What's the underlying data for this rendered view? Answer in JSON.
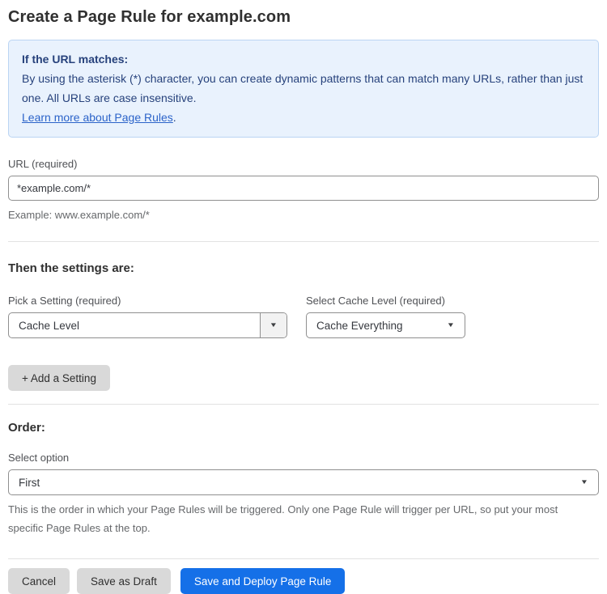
{
  "page": {
    "title": "Create a Page Rule for example.com"
  },
  "info_box": {
    "heading": "If the URL matches:",
    "body": "By using the asterisk (*) character, you can create dynamic patterns that can match many URLs, rather than just one. All URLs are case insensitive.",
    "link_label": "Learn more about Page Rules",
    "link_suffix": "."
  },
  "url_field": {
    "label": "URL (required)",
    "value": "*example.com/*",
    "helper": "Example: www.example.com/*"
  },
  "settings_section": {
    "heading": "Then the settings are:",
    "pick_setting": {
      "label": "Pick a Setting (required)",
      "value": "Cache Level"
    },
    "cache_level": {
      "label": "Select Cache Level (required)",
      "value": "Cache Everything"
    },
    "add_setting_label": "+ Add a Setting"
  },
  "order_section": {
    "heading": "Order:",
    "select_label": "Select option",
    "value": "First",
    "helper": "This is the order in which your Page Rules will be triggered. Only one Page Rule will trigger per URL, so put your most specific Page Rules at the top."
  },
  "actions": {
    "cancel": "Cancel",
    "save_draft": "Save as Draft",
    "save_deploy": "Save and Deploy Page Rule"
  },
  "icons": {
    "dropdown_arrow": "▼"
  },
  "colors": {
    "accent_blue": "#1570e8",
    "info_bg": "#e9f2fd",
    "info_border": "#bad4f3",
    "info_text": "#27427c",
    "link_blue": "#2b63c9",
    "button_grey": "#d9d9d9"
  }
}
